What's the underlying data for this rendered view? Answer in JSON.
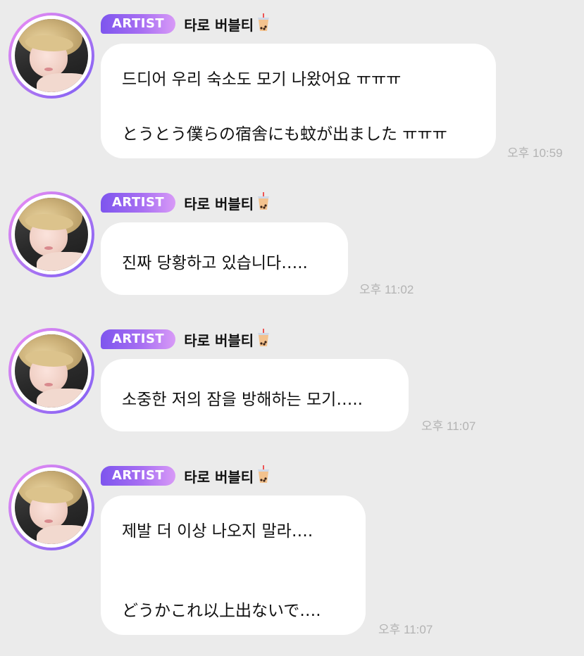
{
  "chat": {
    "messages": [
      {
        "badge": "ARTIST",
        "author": "타로 버블티",
        "author_icon": "bubble-tea-icon",
        "lines": [
          "드디어 우리 숙소도 모기 나왔어요 ㅠㅠㅠ",
          "とうとう僕らの宿舎にも蚊が出ました ㅠㅠㅠ"
        ],
        "time": "오후 10:59"
      },
      {
        "badge": "ARTIST",
        "author": "타로 버블티",
        "author_icon": "bubble-tea-icon",
        "lines": [
          "진짜 당황하고 있습니다….."
        ],
        "time": "오후 11:02"
      },
      {
        "badge": "ARTIST",
        "author": "타로 버블티",
        "author_icon": "bubble-tea-icon",
        "lines": [
          "소중한 저의 잠을 방해하는 모기….."
        ],
        "time": "오후 11:07"
      },
      {
        "badge": "ARTIST",
        "author": "타로 버블티",
        "author_icon": "bubble-tea-icon",
        "lines": [
          "제발 더 이상 나오지 말라….",
          "どうかこれ以上出ないで…."
        ],
        "time": "오후 11:07"
      }
    ]
  },
  "colors": {
    "background": "#ebebeb",
    "bubble": "#ffffff",
    "badge_gradient_start": "#7d55ee",
    "badge_gradient_end": "#d89af7",
    "timestamp": "#b3b3b3"
  }
}
